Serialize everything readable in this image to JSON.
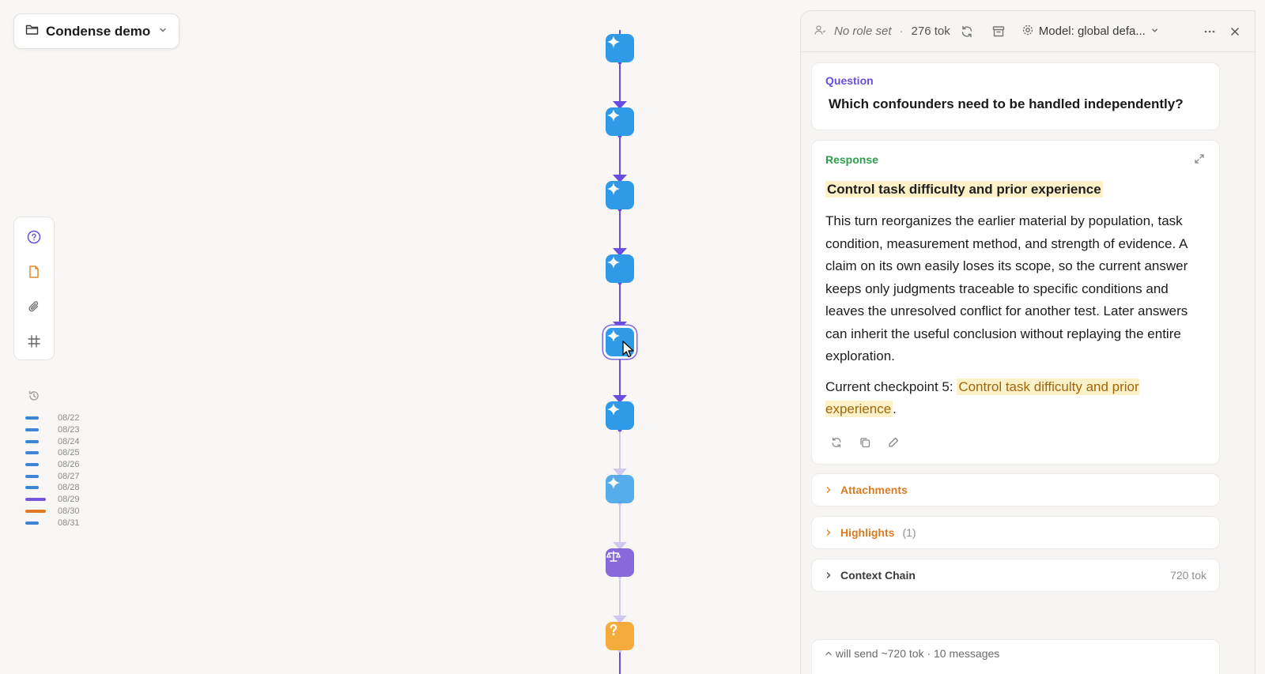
{
  "project": {
    "name": "Condense demo"
  },
  "history": {
    "dates": [
      {
        "label": "08/22",
        "color": "#3e85d6"
      },
      {
        "label": "08/23",
        "color": "#3e85d6"
      },
      {
        "label": "08/24",
        "color": "#3e85d6"
      },
      {
        "label": "08/25",
        "color": "#3e85d6"
      },
      {
        "label": "08/26",
        "color": "#3e85d6"
      },
      {
        "label": "08/27",
        "color": "#3e85d6"
      },
      {
        "label": "08/28",
        "color": "#3e85d6"
      },
      {
        "label": "08/29",
        "color": "#7656d8"
      },
      {
        "label": "08/30",
        "color": "#e07a24"
      },
      {
        "label": "08/31",
        "color": "#3e85d6"
      }
    ]
  },
  "graph": {
    "nodes": [
      {
        "type": "response",
        "icon": "sparkle-icon",
        "state": "done"
      },
      {
        "type": "response",
        "icon": "sparkle-icon",
        "state": "done"
      },
      {
        "type": "response",
        "icon": "sparkle-icon",
        "state": "done"
      },
      {
        "type": "response",
        "icon": "sparkle-icon",
        "state": "done"
      },
      {
        "type": "response",
        "icon": "sparkle-icon",
        "state": "selected"
      },
      {
        "type": "response",
        "icon": "sparkle-icon",
        "state": "done"
      },
      {
        "type": "response",
        "icon": "sparkle-icon",
        "state": "faded"
      },
      {
        "type": "compare",
        "icon": "scale-icon",
        "state": "faded"
      },
      {
        "type": "question",
        "icon": "question-icon",
        "state": "faded"
      }
    ],
    "colors": {
      "response": "#2f9ae8",
      "compare": "#7a5ad8",
      "question": "#f4a52a",
      "edge": "#6a4de0",
      "edge_faded": "#cfc9ef"
    }
  },
  "panel": {
    "role": "No role set",
    "separator": "·",
    "tokens": "276 tok",
    "model": "Model: global defa...",
    "question": {
      "label": "Question",
      "text": "Which confounders need to be handled independently?"
    },
    "response": {
      "label": "Response",
      "title": "Control task difficulty and prior experience",
      "body": "This turn reorganizes the earlier material by population, task condition, measurement method, and strength of evidence. A claim on its own easily loses its scope, so the current answer keeps only judgments traceable to specific conditions and leaves the unresolved conflict for another test. Later answers can inherit the useful conclusion without replaying the entire exploration.",
      "checkpoint_prefix": "Current checkpoint 5: ",
      "checkpoint_highlight": "Control task difficulty and prior experience",
      "checkpoint_suffix": "."
    },
    "attachments": {
      "label": "Attachments"
    },
    "highlights": {
      "label": "Highlights",
      "count": "(1)"
    },
    "context_chain": {
      "label": "Context Chain",
      "tokens": "720 tok"
    },
    "send_info": "will send ~720 tok · 10 messages"
  }
}
